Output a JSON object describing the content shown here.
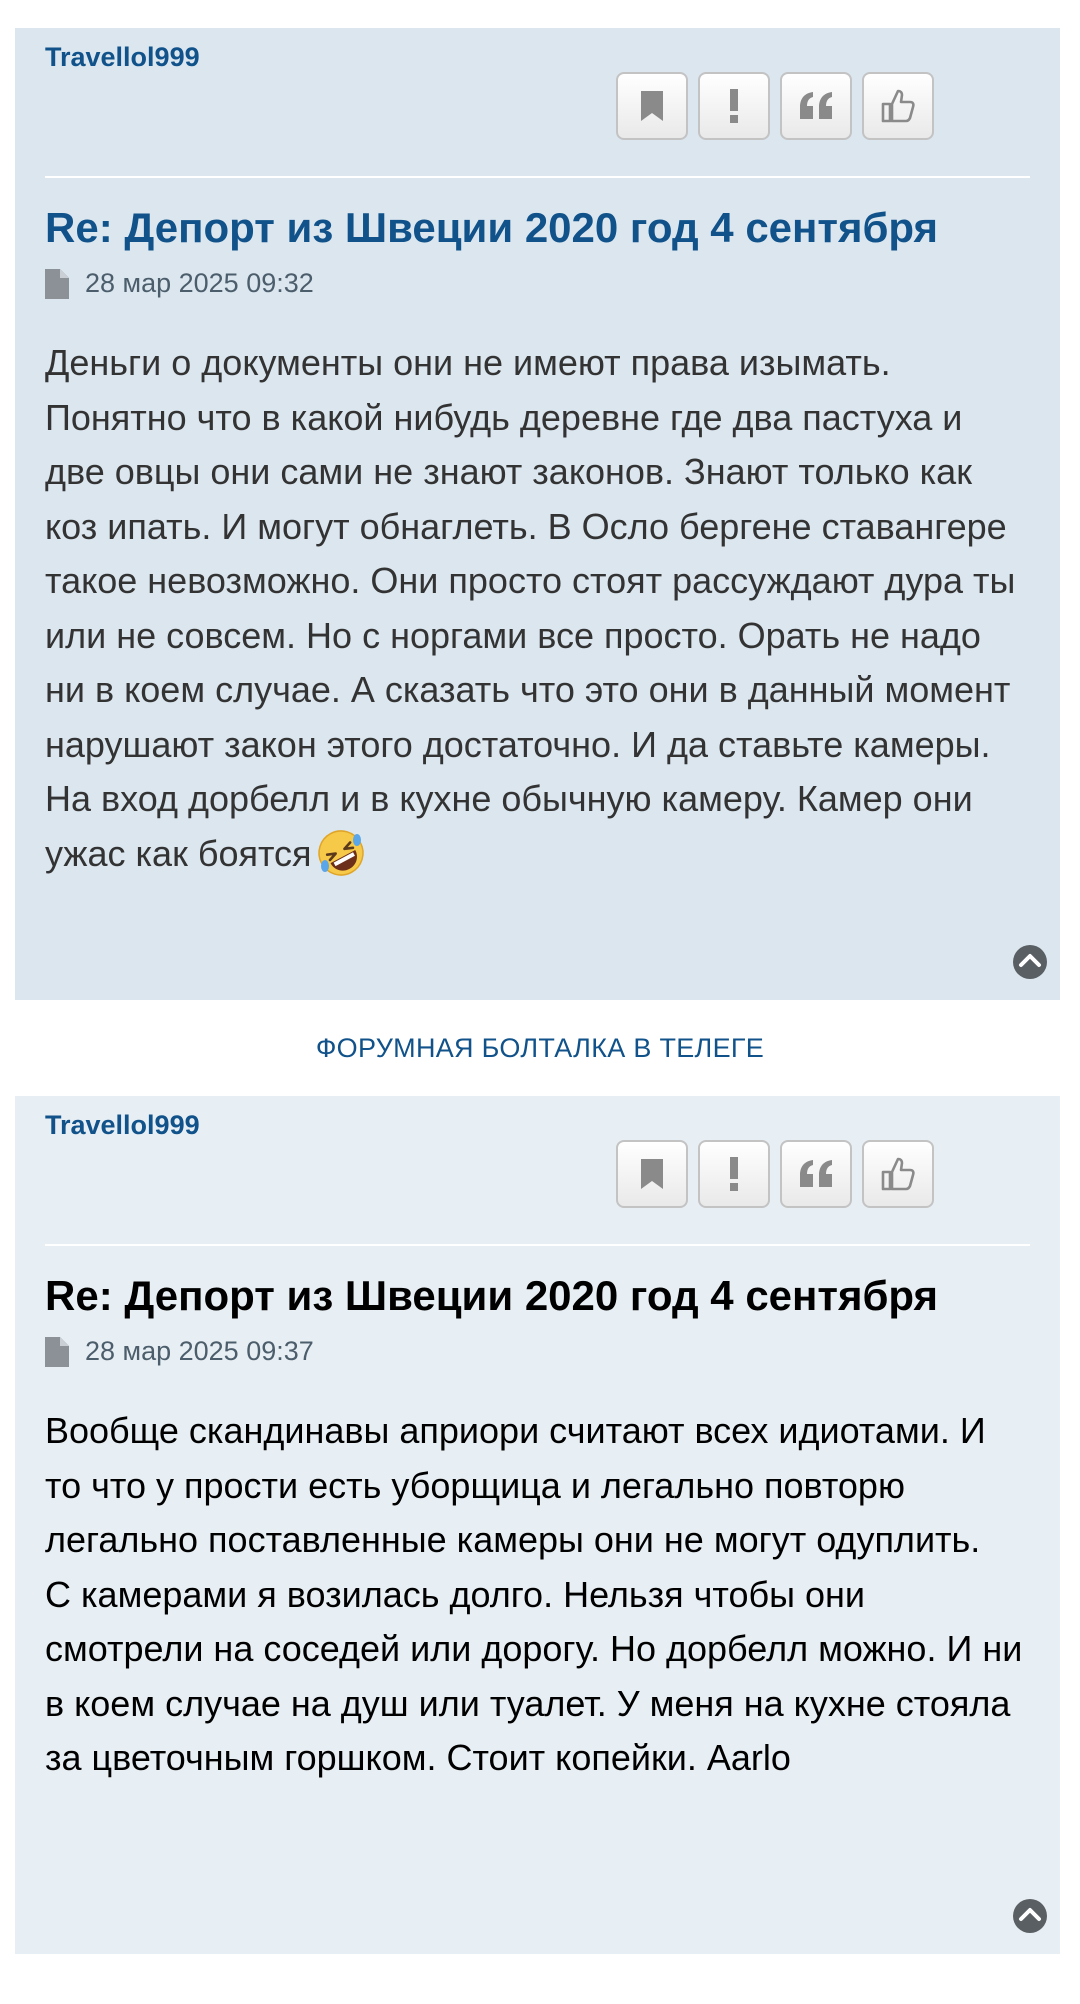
{
  "posts": [
    {
      "author": "Travellol999",
      "title": "Re: Депорт из Швеции 2020 год 4 сентября",
      "date": "28 мар 2025 09:32",
      "content": "Деньги о документы они не имеют права изымать. Понятно что в какой нибудь деревне где два пастуха и две овцы они сами не знают законов. Знают только как коз ипать. И могут обнаглеть. В Осло бергене ставангере такое невозможно. Они просто стоят рассуждают дура ты или не совсем. Но с норгами все просто. Орать не надо ни в коем случае. А сказать что это они в данный момент нарушают закон этого достаточно. И да ставьте камеры. На вход дорбелл и в кухне обычную камеру. Камер они ужас как боятся",
      "emoji": "rolling-on-floor-laughing-emoji"
    },
    {
      "author": "Travellol999",
      "title": "Re: Депорт из Швеции 2020 год 4 сентября",
      "date": "28 мар 2025 09:37",
      "content": "Вообще скандинавы априори считают всех идиотами. И то что у прости есть уборщица и легально повторю легально поставленные камеры они не могут одуплить.\nС камерами я возилась долго. Нельзя чтобы они смотрели на соседей или дорогу. Но дорбелл можно. И ни в коем случае на душ или туалет. У меня на кухне стояла за цветочным горшком. Стоит копейки. Aarlo"
    }
  ],
  "between_link": "ФОРУМНАЯ БОЛТАЛКА В ТЕЛЕГЕ",
  "icons": [
    "bookmark-icon",
    "report-icon",
    "quote-icon",
    "like-icon",
    "file-icon",
    "back-to-top-icon"
  ],
  "colors": {
    "post1_bg": "#dbe6ef",
    "post2_bg": "#e8eff4",
    "link": "#105289",
    "author": "#105289"
  }
}
